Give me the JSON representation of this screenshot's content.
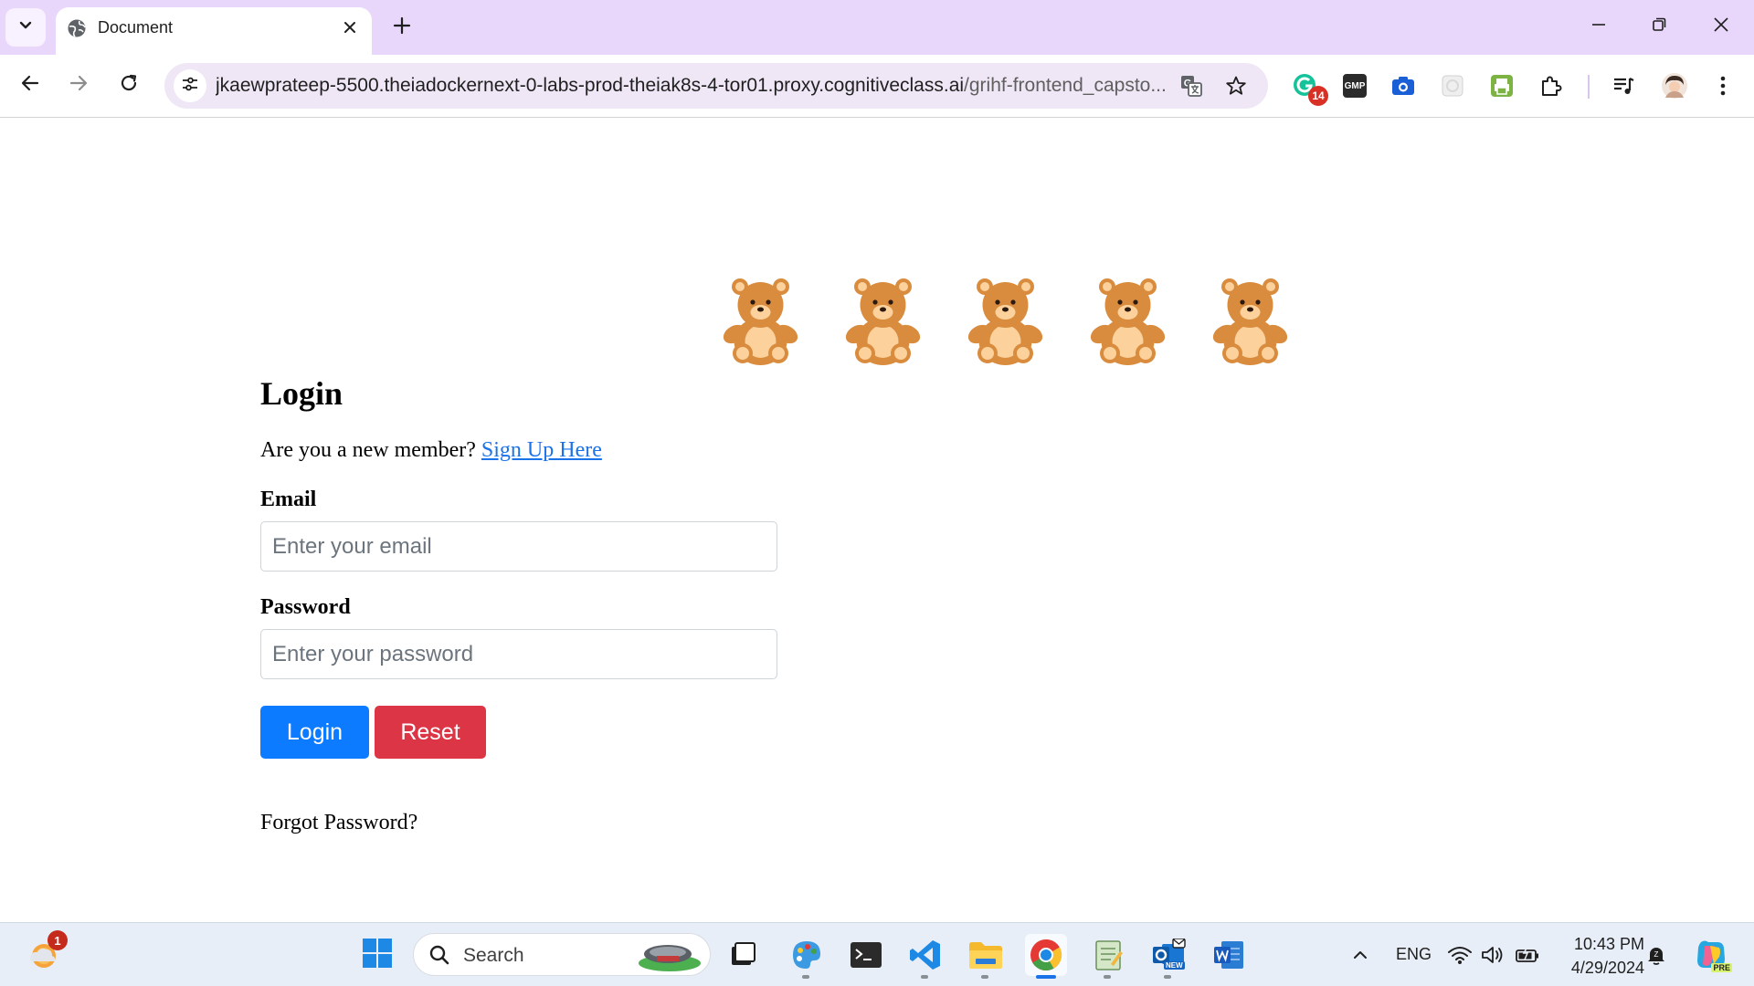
{
  "browser": {
    "tab": {
      "title": "Document"
    },
    "address": {
      "host": "jkaewprateep-5500.theiadockernext-0-labs-prod-theiak8s-4-tor01.proxy.cognitiveclass.ai",
      "path": "/grihf-frontend_capsto..."
    },
    "extensions": {
      "badge_count": "14",
      "gmp_label": "GMP"
    }
  },
  "page": {
    "title": "Login",
    "new_member_text": "Are you a new member?",
    "signup_link": "Sign Up Here",
    "email_label": "Email",
    "email_placeholder": "Enter your email",
    "password_label": "Password",
    "password_placeholder": "Enter your password",
    "login_button": "Login",
    "reset_button": "Reset",
    "forgot_password": "Forgot Password?",
    "bear_count": 5
  },
  "colors": {
    "tabstrip": "#e9d7fb",
    "omnibox": "#efe7f6",
    "link": "#1a73e8",
    "login_button": "#0d7bff",
    "reset_button": "#dc3545",
    "bear_fur": "#d98c3e",
    "bear_belly": "#fcd19b"
  },
  "taskbar": {
    "search_label": "Search",
    "notification_badge": "1",
    "language": "ENG",
    "time": "10:43 PM",
    "date": "4/29/2024",
    "outlook_badge": "NEW",
    "copilot_badge": "PRE"
  }
}
